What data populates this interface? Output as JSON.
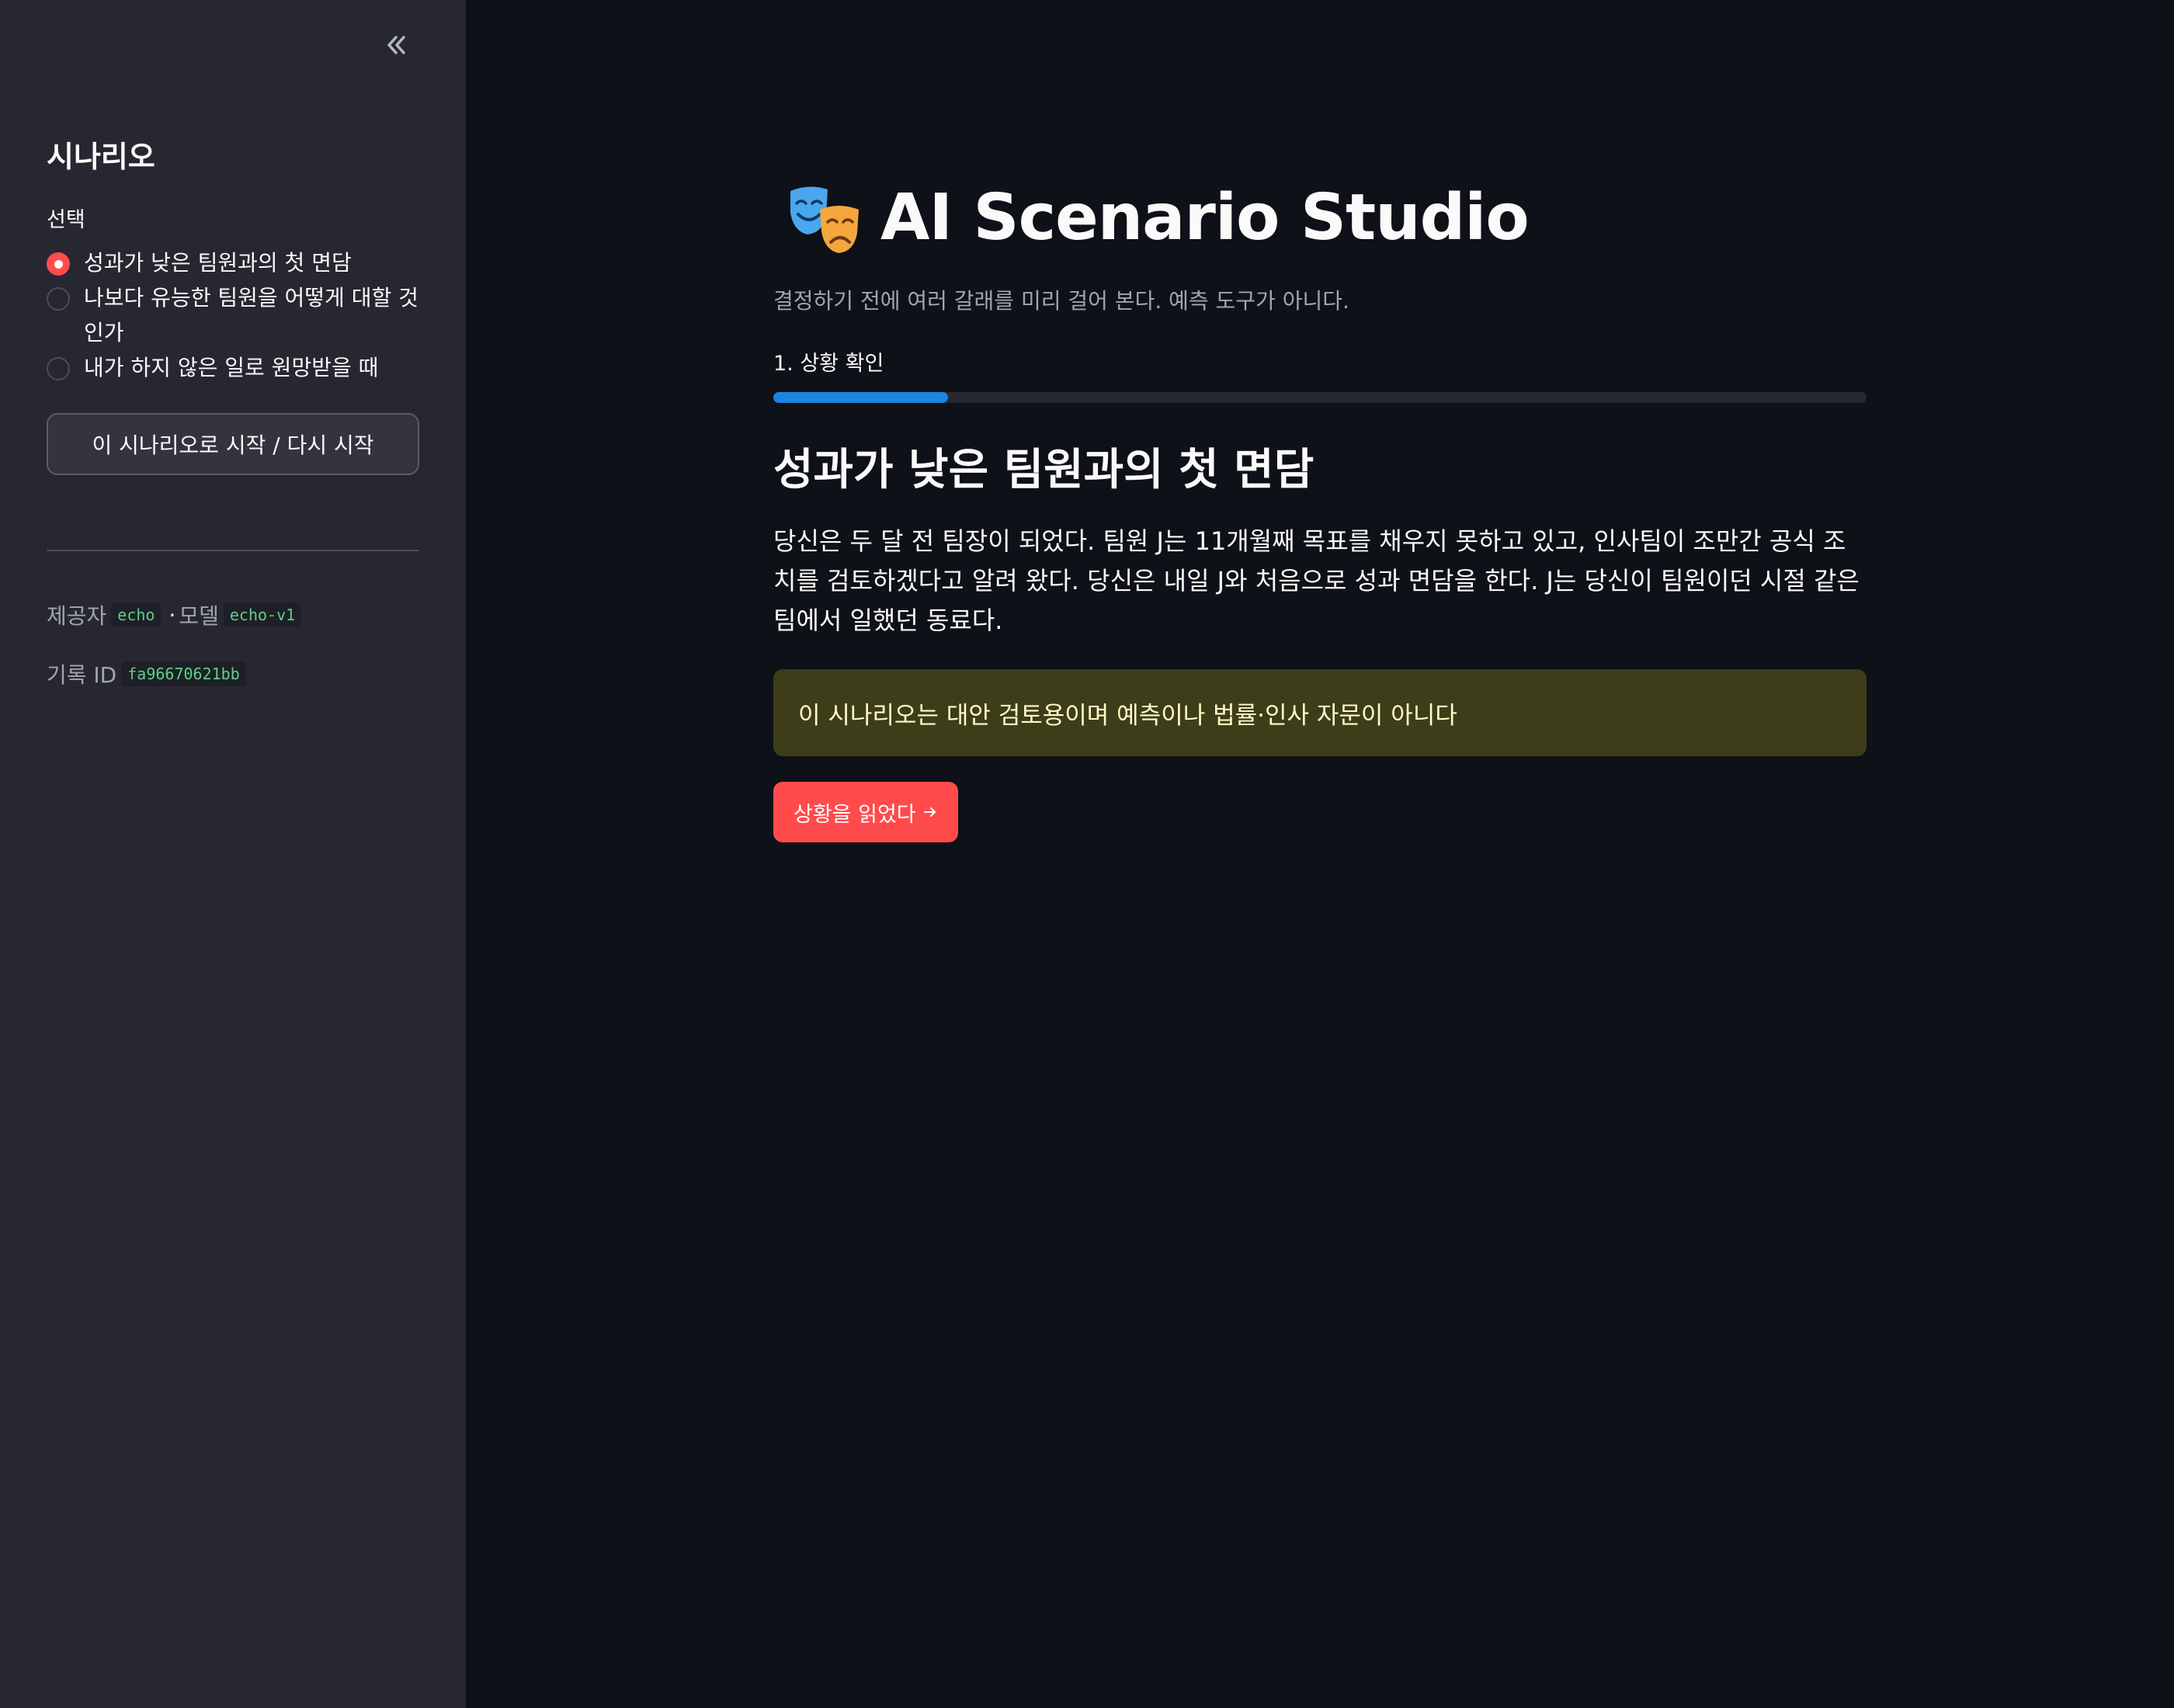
{
  "sidebar": {
    "collapse_icon": "double-chevron-left-icon",
    "title": "시나리오",
    "select_label": "선택",
    "options": [
      {
        "label": "성과가 낮은 팀원과의 첫 면담",
        "checked": true
      },
      {
        "label": "나보다 유능한 팀원을 어떻게 대할 것인가",
        "checked": false
      },
      {
        "label": "내가 하지 않은 일로 원망받을 때",
        "checked": false
      }
    ],
    "start_button": "이 시나리오로 시작 / 다시 시작",
    "provider_label": "제공자",
    "provider_value": "echo",
    "separator": "·",
    "model_label": "모델",
    "model_value": "echo-v1",
    "record_label": "기록 ID",
    "record_value": "fa96670621bb"
  },
  "main": {
    "app_icon": "performing-arts-masks-icon",
    "app_title": "AI Scenario Studio",
    "subtitle": "결정하기 전에 여러 갈래를 미리 걸어 본다. 예측 도구가 아니다.",
    "progress_label": "1. 상황 확인",
    "progress_fraction": 0.16,
    "scenario_title": "성과가 낮은 팀원과의 첫 면담",
    "scenario_description": "당신은 두 달 전 팀장이 되었다. 팀원 J는 11개월째 목표를 채우지 못하고 있고, 인사팀이 조만간 공식 조치를 검토하겠다고 알려 왔다. 당신은 내일 J와 처음으로 성과 면담을 한다. J는 당신이 팀원이던 시절 같은 팀에서 일했던 동료다.",
    "warning_text": "이 시나리오는 대안 검토용이며 예측이나 법률·인사 자문이 아니다",
    "next_button": "상황을 읽었다",
    "next_icon": "arrow-right-icon"
  },
  "colors": {
    "background": "#0e1117",
    "sidebar_background": "#262730",
    "accent": "#ff4b4b",
    "progress": "#1c83e1",
    "warning_background": "#3e3d19",
    "warning_text": "#fffbc9",
    "code_text": "#5fcf86"
  }
}
